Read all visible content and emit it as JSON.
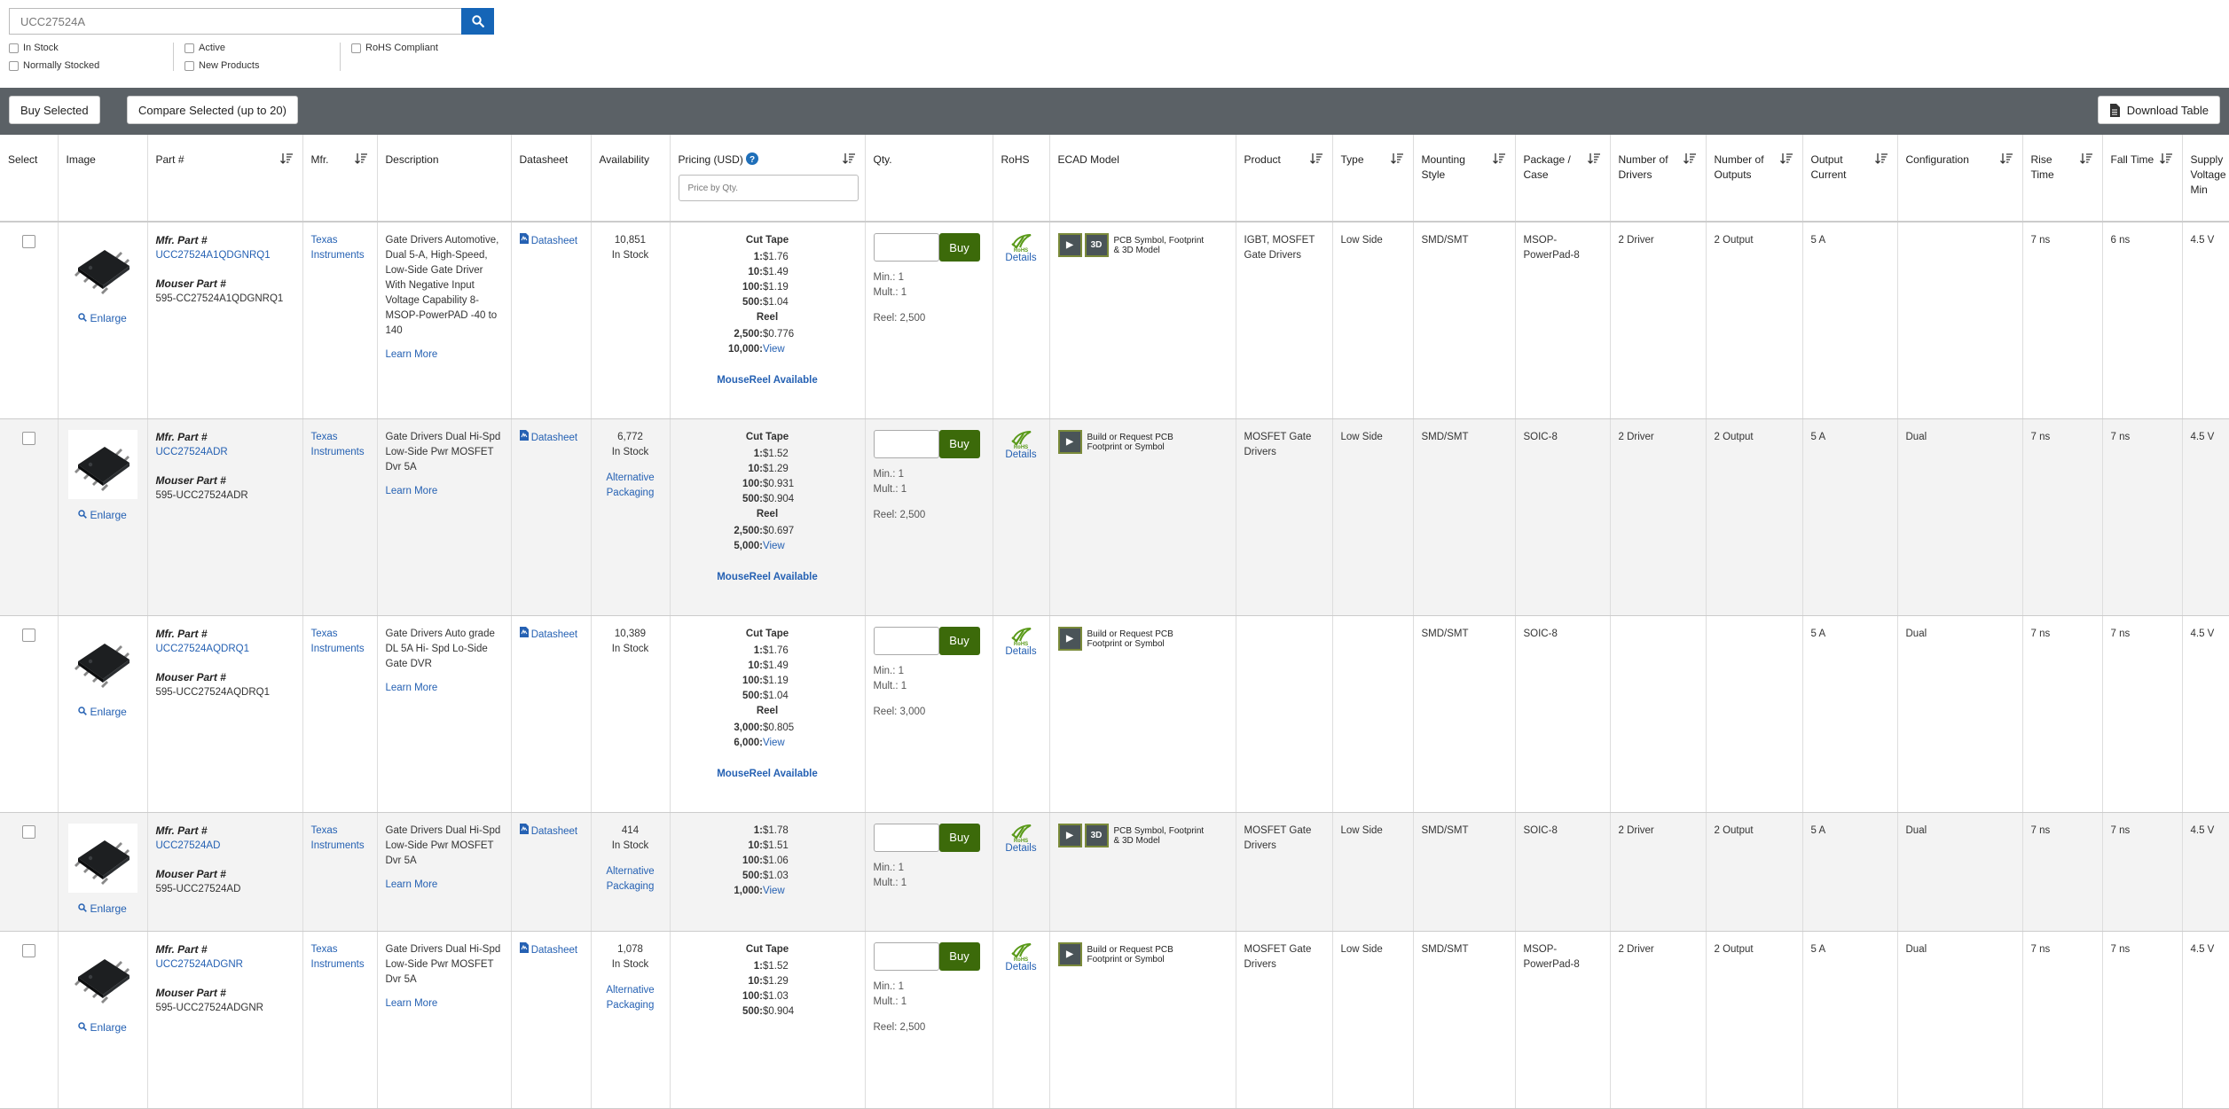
{
  "search": {
    "value": "UCC27524A"
  },
  "filters": [
    [
      {
        "label": "In Stock"
      },
      {
        "label": "Normally Stocked"
      }
    ],
    [
      {
        "label": "Active"
      },
      {
        "label": "New Products"
      }
    ],
    [
      {
        "label": "RoHS Compliant"
      }
    ]
  ],
  "toolbar": {
    "buy_selected": "Buy Selected",
    "compare_selected": "Compare Selected (up to 20)",
    "download_table": "Download Table"
  },
  "headers": {
    "select": "Select",
    "image": "Image",
    "part": "Part #",
    "mfr": "Mfr.",
    "description": "Description",
    "datasheet": "Datasheet",
    "availability": "Availability",
    "pricing": "Pricing (USD)",
    "price_placeholder": "Price by Qty.",
    "qty": "Qty.",
    "rohs": "RoHS",
    "ecad": "ECAD Model",
    "product": "Product",
    "type": "Type",
    "mounting": "Mounting Style",
    "package": "Package / Case",
    "drivers": "Number of Drivers",
    "outputs": "Number of Outputs",
    "output_current": "Output Current",
    "configuration": "Configuration",
    "rise": "Rise Time",
    "fall": "Fall Time",
    "supply": "Supply Voltage - Min"
  },
  "labels": {
    "mfr_part": "Mfr. Part #",
    "mouser_part": "Mouser Part #",
    "enlarge": "Enlarge",
    "datasheet": "Datasheet",
    "learn_more": "Learn More",
    "buy": "Buy",
    "details": "Details",
    "alt_pkg": "Alternative Packaging",
    "mousereel": "MouseReel Available",
    "view": "View",
    "in_stock": "In Stock"
  },
  "rows": [
    {
      "mfr_part": "UCC27524A1QDGNRQ1",
      "mouser_part": "595-CC27524A1QDGNRQ1",
      "mfr": "Texas Instruments",
      "description": "Gate Drivers Automotive, Dual 5-A, High-Speed, Low-Side Gate Driver With Negative Input Voltage Capability 8-MSOP-PowerPAD -40 to 140",
      "availability": "10,851",
      "alt": false,
      "price_groups": [
        {
          "title": "Cut Tape",
          "rows": [
            [
              "1:",
              "$1.76"
            ],
            [
              "10:",
              "$1.49"
            ],
            [
              "100:",
              "$1.19"
            ],
            [
              "500:",
              "$1.04"
            ]
          ]
        },
        {
          "title": "Reel",
          "rows": [
            [
              "2,500:",
              "$0.776"
            ],
            [
              "10,000:",
              "View"
            ]
          ]
        }
      ],
      "mousereel": true,
      "min": "Min.: 1",
      "mult": "Mult.: 1",
      "reel": "Reel: 2,500",
      "ecad": "PCB Symbol, Footprint & 3D Model",
      "ecad_3d": true,
      "product": "IGBT, MOSFET Gate Drivers",
      "type": "Low Side",
      "mounting": "SMD/SMT",
      "package": "MSOP-PowerPad-8",
      "drivers": "2 Driver",
      "outputs": "2 Output",
      "current": "5 A",
      "config": "",
      "rise": "7 ns",
      "fall": "6 ns",
      "supply": "4.5 V"
    },
    {
      "mfr_part": "UCC27524ADR",
      "mouser_part": "595-UCC27524ADR",
      "mfr": "Texas Instruments",
      "description": "Gate Drivers Dual Hi-Spd Low-Side Pwr MOSFET Dvr 5A",
      "availability": "6,772",
      "alt": true,
      "price_groups": [
        {
          "title": "Cut Tape",
          "rows": [
            [
              "1:",
              "$1.52"
            ],
            [
              "10:",
              "$1.29"
            ],
            [
              "100:",
              "$0.931"
            ],
            [
              "500:",
              "$0.904"
            ]
          ]
        },
        {
          "title": "Reel",
          "rows": [
            [
              "2,500:",
              "$0.697"
            ],
            [
              "5,000:",
              "View"
            ]
          ]
        }
      ],
      "mousereel": true,
      "min": "Min.: 1",
      "mult": "Mult.: 1",
      "reel": "Reel: 2,500",
      "ecad": "Build or Request PCB Footprint or Symbol",
      "ecad_3d": false,
      "product": "MOSFET Gate Drivers",
      "type": "Low Side",
      "mounting": "SMD/SMT",
      "package": "SOIC-8",
      "drivers": "2 Driver",
      "outputs": "2 Output",
      "current": "5 A",
      "config": "Dual",
      "rise": "7 ns",
      "fall": "7 ns",
      "supply": "4.5 V"
    },
    {
      "mfr_part": "UCC27524AQDRQ1",
      "mouser_part": "595-UCC27524AQDRQ1",
      "mfr": "Texas Instruments",
      "description": "Gate Drivers Auto grade DL 5A Hi- Spd Lo-Side Gate DVR",
      "availability": "10,389",
      "alt": false,
      "price_groups": [
        {
          "title": "Cut Tape",
          "rows": [
            [
              "1:",
              "$1.76"
            ],
            [
              "10:",
              "$1.49"
            ],
            [
              "100:",
              "$1.19"
            ],
            [
              "500:",
              "$1.04"
            ]
          ]
        },
        {
          "title": "Reel",
          "rows": [
            [
              "3,000:",
              "$0.805"
            ],
            [
              "6,000:",
              "View"
            ]
          ]
        }
      ],
      "mousereel": true,
      "min": "Min.: 1",
      "mult": "Mult.: 1",
      "reel": "Reel: 3,000",
      "ecad": "Build or Request PCB Footprint or Symbol",
      "ecad_3d": false,
      "product": "",
      "type": "",
      "mounting": "SMD/SMT",
      "package": "SOIC-8",
      "drivers": "",
      "outputs": "",
      "current": "5 A",
      "config": "Dual",
      "rise": "7 ns",
      "fall": "7 ns",
      "supply": "4.5 V"
    },
    {
      "mfr_part": "UCC27524AD",
      "mouser_part": "595-UCC27524AD",
      "mfr": "Texas Instruments",
      "description": "Gate Drivers Dual Hi-Spd Low-Side Pwr MOSFET Dvr 5A",
      "availability": "414",
      "alt": true,
      "price_groups": [
        {
          "title": "",
          "rows": [
            [
              "1:",
              "$1.78"
            ],
            [
              "10:",
              "$1.51"
            ],
            [
              "100:",
              "$1.06"
            ],
            [
              "500:",
              "$1.03"
            ],
            [
              "1,000:",
              "View"
            ]
          ]
        }
      ],
      "mousereel": false,
      "min": "Min.: 1",
      "mult": "Mult.: 1",
      "reel": "",
      "ecad": "PCB Symbol, Footprint & 3D Model",
      "ecad_3d": true,
      "product": "MOSFET Gate Drivers",
      "type": "Low Side",
      "mounting": "SMD/SMT",
      "package": "SOIC-8",
      "drivers": "2 Driver",
      "outputs": "2 Output",
      "current": "5 A",
      "config": "Dual",
      "rise": "7 ns",
      "fall": "7 ns",
      "supply": "4.5 V"
    },
    {
      "mfr_part": "UCC27524ADGNR",
      "mouser_part": "595-UCC27524ADGNR",
      "mfr": "Texas Instruments",
      "description": "Gate Drivers Dual Hi-Spd Low-Side Pwr MOSFET Dvr 5A",
      "availability": "1,078",
      "alt": true,
      "price_groups": [
        {
          "title": "Cut Tape",
          "rows": [
            [
              "1:",
              "$1.52"
            ],
            [
              "10:",
              "$1.29"
            ],
            [
              "100:",
              "$1.03"
            ],
            [
              "500:",
              "$0.904"
            ]
          ]
        }
      ],
      "mousereel": false,
      "min": "Min.: 1",
      "mult": "Mult.: 1",
      "reel": "Reel: 2,500",
      "ecad": "Build or Request PCB Footprint or Symbol",
      "ecad_3d": false,
      "product": "MOSFET Gate Drivers",
      "type": "Low Side",
      "mounting": "SMD/SMT",
      "package": "MSOP-PowerPad-8",
      "drivers": "2 Driver",
      "outputs": "2 Output",
      "current": "5 A",
      "config": "Dual",
      "rise": "7 ns",
      "fall": "7 ns",
      "supply": "4.5 V"
    }
  ]
}
